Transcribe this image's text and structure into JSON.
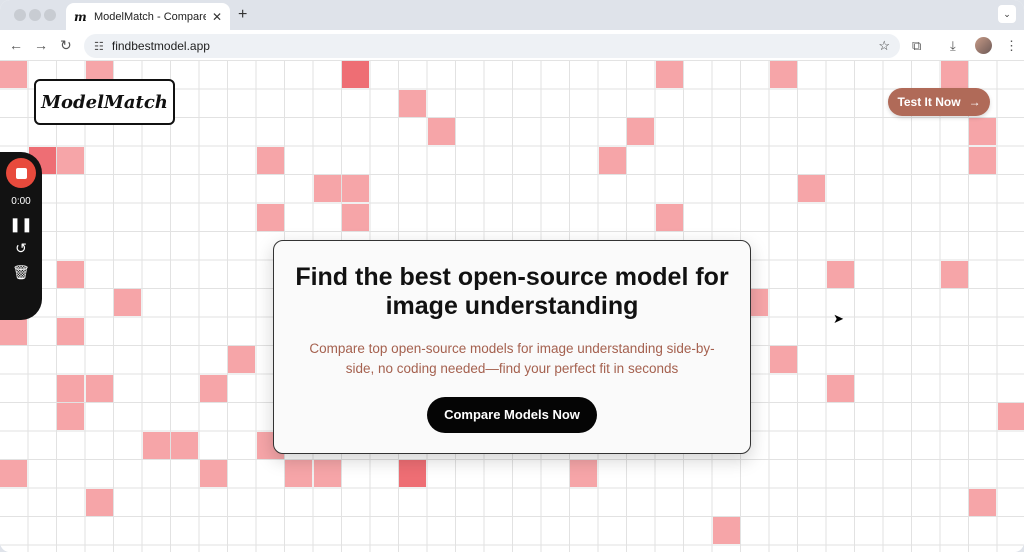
{
  "browser": {
    "tab_title": "ModelMatch - Compare Visio",
    "tab_favicon": "m",
    "tab_close": "✕",
    "new_tab": "+",
    "url": "findbestmodel.app"
  },
  "header": {
    "logo": "ModelMatch",
    "cta_label": "Test It Now",
    "cta_arrow": "→"
  },
  "recorder": {
    "time": "0:00"
  },
  "hero": {
    "title": "Find the best open-source model for image understanding",
    "subtitle": "Compare top open-source models for image understanding side-by-side, no coding needed—find your perfect fit in seconds",
    "cta_label": "Compare Models Now"
  },
  "colors": {
    "accent_button": "#b06a58",
    "subtitle_text": "#a5614f",
    "grid_cell": "#f6a5a8",
    "grid_cell_dark": "#ee6e74"
  },
  "icons": [
    "tune-icon",
    "star-icon",
    "extensions-icon",
    "download-icon",
    "menu-icon",
    "stop-icon",
    "pause-icon",
    "restart-icon",
    "trash-icon",
    "arrow-right-icon",
    "mouse-cursor-icon"
  ]
}
